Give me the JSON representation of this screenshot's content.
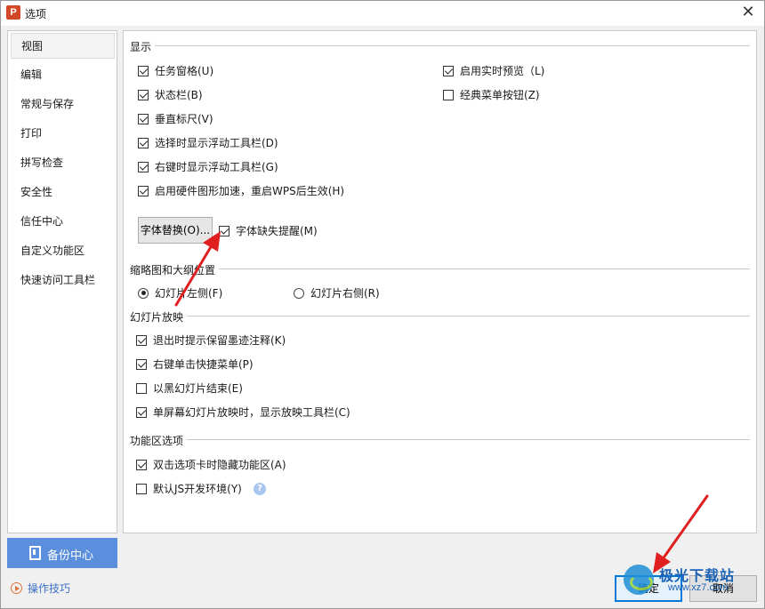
{
  "window": {
    "title": "选项",
    "app_icon_letter": "P",
    "close_glyph": "✕"
  },
  "sidebar": {
    "items": [
      {
        "label": "视图",
        "selected": true
      },
      {
        "label": "编辑"
      },
      {
        "label": "常规与保存"
      },
      {
        "label": "打印"
      },
      {
        "label": "拼写检查"
      },
      {
        "label": "安全性"
      },
      {
        "label": "信任中心"
      },
      {
        "label": "自定义功能区"
      },
      {
        "label": "快速访问工具栏"
      }
    ],
    "backup_label": "备份中心",
    "tips_label": "操作技巧"
  },
  "display": {
    "title": "显示",
    "left_options": [
      {
        "label": "任务窗格(U)",
        "checked": true
      },
      {
        "label": "状态栏(B)",
        "checked": true
      },
      {
        "label": "垂直标尺(V)",
        "checked": true
      },
      {
        "label": "选择时显示浮动工具栏(D)",
        "checked": true
      },
      {
        "label": "右键时显示浮动工具栏(G)",
        "checked": true
      },
      {
        "label": "启用硬件图形加速，重启WPS后生效(H)",
        "checked": true
      }
    ],
    "right_options": [
      {
        "label": "启用实时预览（L)",
        "checked": true
      },
      {
        "label": "经典菜单按钮(Z)",
        "checked": false
      }
    ],
    "font_replace_button": "字体替换(O)...",
    "font_missing_reminder": {
      "label": "字体缺失提醒(M)",
      "checked": true
    }
  },
  "thumbnail": {
    "title": "缩略图和大纲位置",
    "options": [
      {
        "label": "幻灯片左侧(F)",
        "selected": true
      },
      {
        "label": "幻灯片右侧(R)",
        "selected": false
      }
    ]
  },
  "slideshow": {
    "title": "幻灯片放映",
    "options": [
      {
        "label": "退出时提示保留墨迹注释(K)",
        "checked": true
      },
      {
        "label": "右键单击快捷菜单(P)",
        "checked": true
      },
      {
        "label": "以黑幻灯片结束(E)",
        "checked": false
      },
      {
        "label": "单屏幕幻灯片放映时，显示放映工具栏(C)",
        "checked": true
      }
    ]
  },
  "ribbon": {
    "title": "功能区选项",
    "options": [
      {
        "label": "双击选项卡时隐藏功能区(A)",
        "checked": true
      },
      {
        "label": "默认JS开发环境(Y)",
        "checked": false
      }
    ],
    "help_glyph": "?"
  },
  "footer": {
    "ok_label": "确定",
    "cancel_label": "取消"
  },
  "watermark": {
    "text": "极光下载站",
    "url": "www.xz7.com"
  },
  "colors": {
    "accent": "#5b8fde",
    "arrow": "#e02020",
    "focus_border": "#0078d7"
  }
}
